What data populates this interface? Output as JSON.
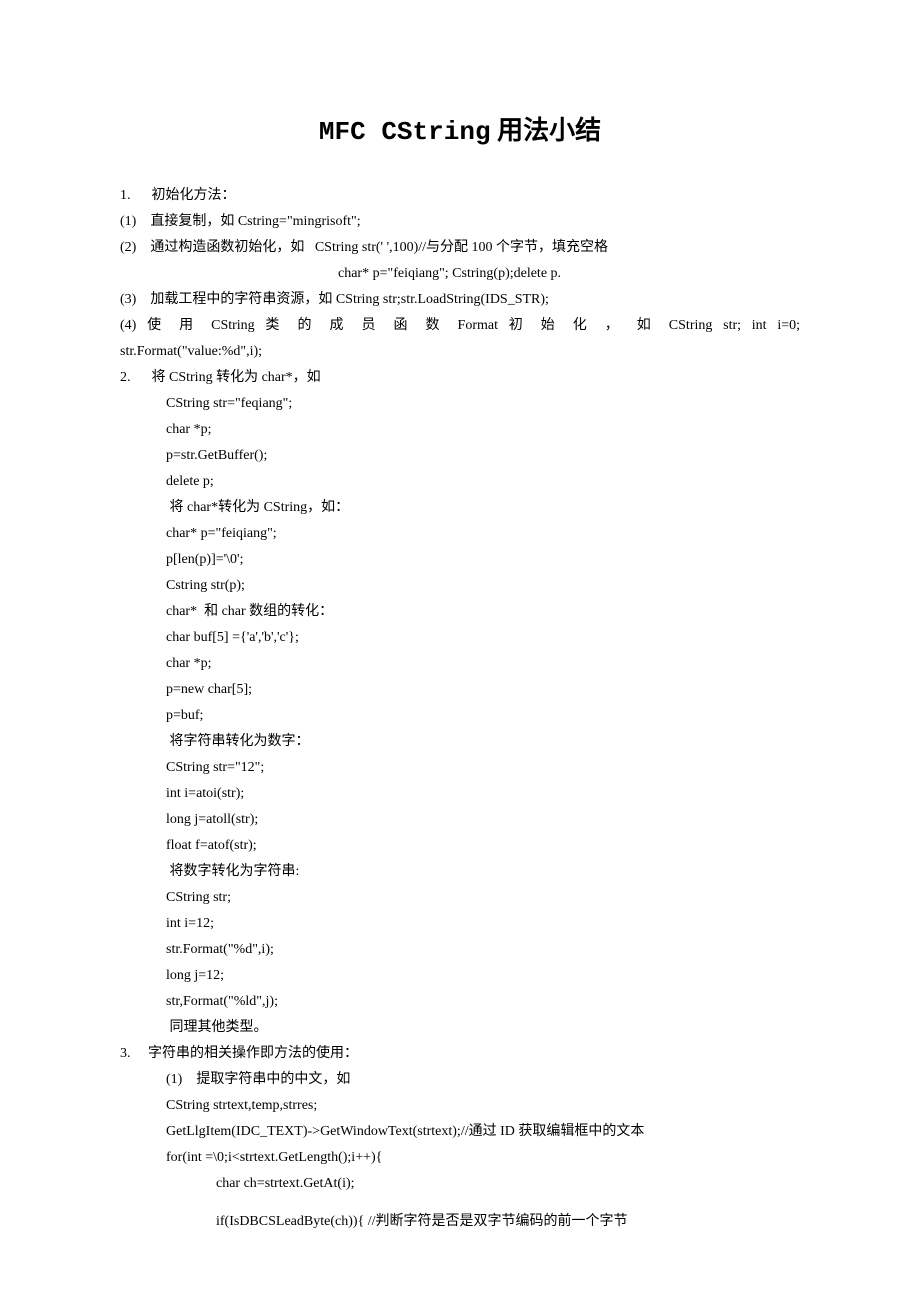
{
  "title_part1": "MFC  CString",
  "title_part2": "  用法小结",
  "lines": [
    {
      "cls": "indent0",
      "text": "1.      初始化方法："
    },
    {
      "cls": "indent0",
      "text": "(1)    直接复制，如 Cstring=\"mingrisoft\";"
    },
    {
      "cls": "indent0",
      "text": "(2)    通过构造函数初始化，如   CString str(' ',100)//与分配 100 个字节，填充空格"
    },
    {
      "cls": "indent-special",
      "text": "char* p=\"feiqiang\"; Cstring(p);delete p."
    },
    {
      "cls": "indent0",
      "text": "(3)    加载工程中的字符串资源，如 CString str;str.LoadString(IDS_STR);"
    },
    {
      "cls": "indent0 justify",
      "text": "(4)    使 用  CString  类 的 成 员 函 数  Format  初 始 化 ， 如  CString  str;  int  i=0;"
    },
    {
      "cls": "indent0",
      "text": "str.Format(\"value:%d\",i);"
    },
    {
      "cls": "indent0",
      "text": "2.      将 CString 转化为 char*，如"
    },
    {
      "cls": "indent1",
      "text": "CString str=\"feqiang\";"
    },
    {
      "cls": "indent1",
      "text": "char *p;"
    },
    {
      "cls": "indent1",
      "text": "p=str.GetBuffer();"
    },
    {
      "cls": "indent1",
      "text": "delete p;"
    },
    {
      "cls": "indent1",
      "text": " 将 char*转化为 CString，如："
    },
    {
      "cls": "indent1",
      "text": "char* p=\"feiqiang\";"
    },
    {
      "cls": "indent1",
      "text": "p[len(p)]='\\0';"
    },
    {
      "cls": "indent1",
      "text": "Cstring str(p);"
    },
    {
      "cls": "indent1",
      "text": "char*  和 char 数组的转化："
    },
    {
      "cls": "indent1",
      "text": "char buf[5] ={'a','b','c'};"
    },
    {
      "cls": "indent1",
      "text": "char *p;"
    },
    {
      "cls": "indent1",
      "text": "p=new char[5];"
    },
    {
      "cls": "indent1",
      "text": "p=buf;"
    },
    {
      "cls": "indent1",
      "text": " 将字符串转化为数字："
    },
    {
      "cls": "indent1",
      "text": "CString str=\"12\";"
    },
    {
      "cls": "indent1",
      "text": "int i=atoi(str);"
    },
    {
      "cls": "indent1",
      "text": "long j=atoll(str);"
    },
    {
      "cls": "indent1",
      "text": "float f=atof(str);"
    },
    {
      "cls": "indent1",
      "text": " 将数字转化为字符串:"
    },
    {
      "cls": "indent1",
      "text": "CString str;"
    },
    {
      "cls": "indent1",
      "text": "int i=12;"
    },
    {
      "cls": "indent1",
      "text": "str.Format(\"%d\",i);"
    },
    {
      "cls": "indent1",
      "text": "long j=12;"
    },
    {
      "cls": "indent1",
      "text": "str,Format(\"%ld\",j);"
    },
    {
      "cls": "indent1",
      "text": " 同理其他类型。"
    },
    {
      "cls": "indent0",
      "text": "3.     字符串的相关操作即方法的使用："
    },
    {
      "cls": "indent1",
      "text": "(1)    提取字符串中的中文，如"
    },
    {
      "cls": "indent1",
      "text": "CString strtext,temp,strres;"
    },
    {
      "cls": "indent1",
      "text": "GetLlgItem(IDC_TEXT)->GetWindowText(strtext);//通过 ID 获取编辑框中的文本"
    },
    {
      "cls": "indent1",
      "text": "for(int =\\0;i<strtext.GetLength();i++){"
    },
    {
      "cls": "indent2",
      "text": "char ch=strtext.GetAt(i);"
    },
    {
      "cls": "indent2 gap-top",
      "text": "if(IsDBCSLeadByte(ch)){ //判断字符是否是双字节编码的前一个字节"
    }
  ]
}
